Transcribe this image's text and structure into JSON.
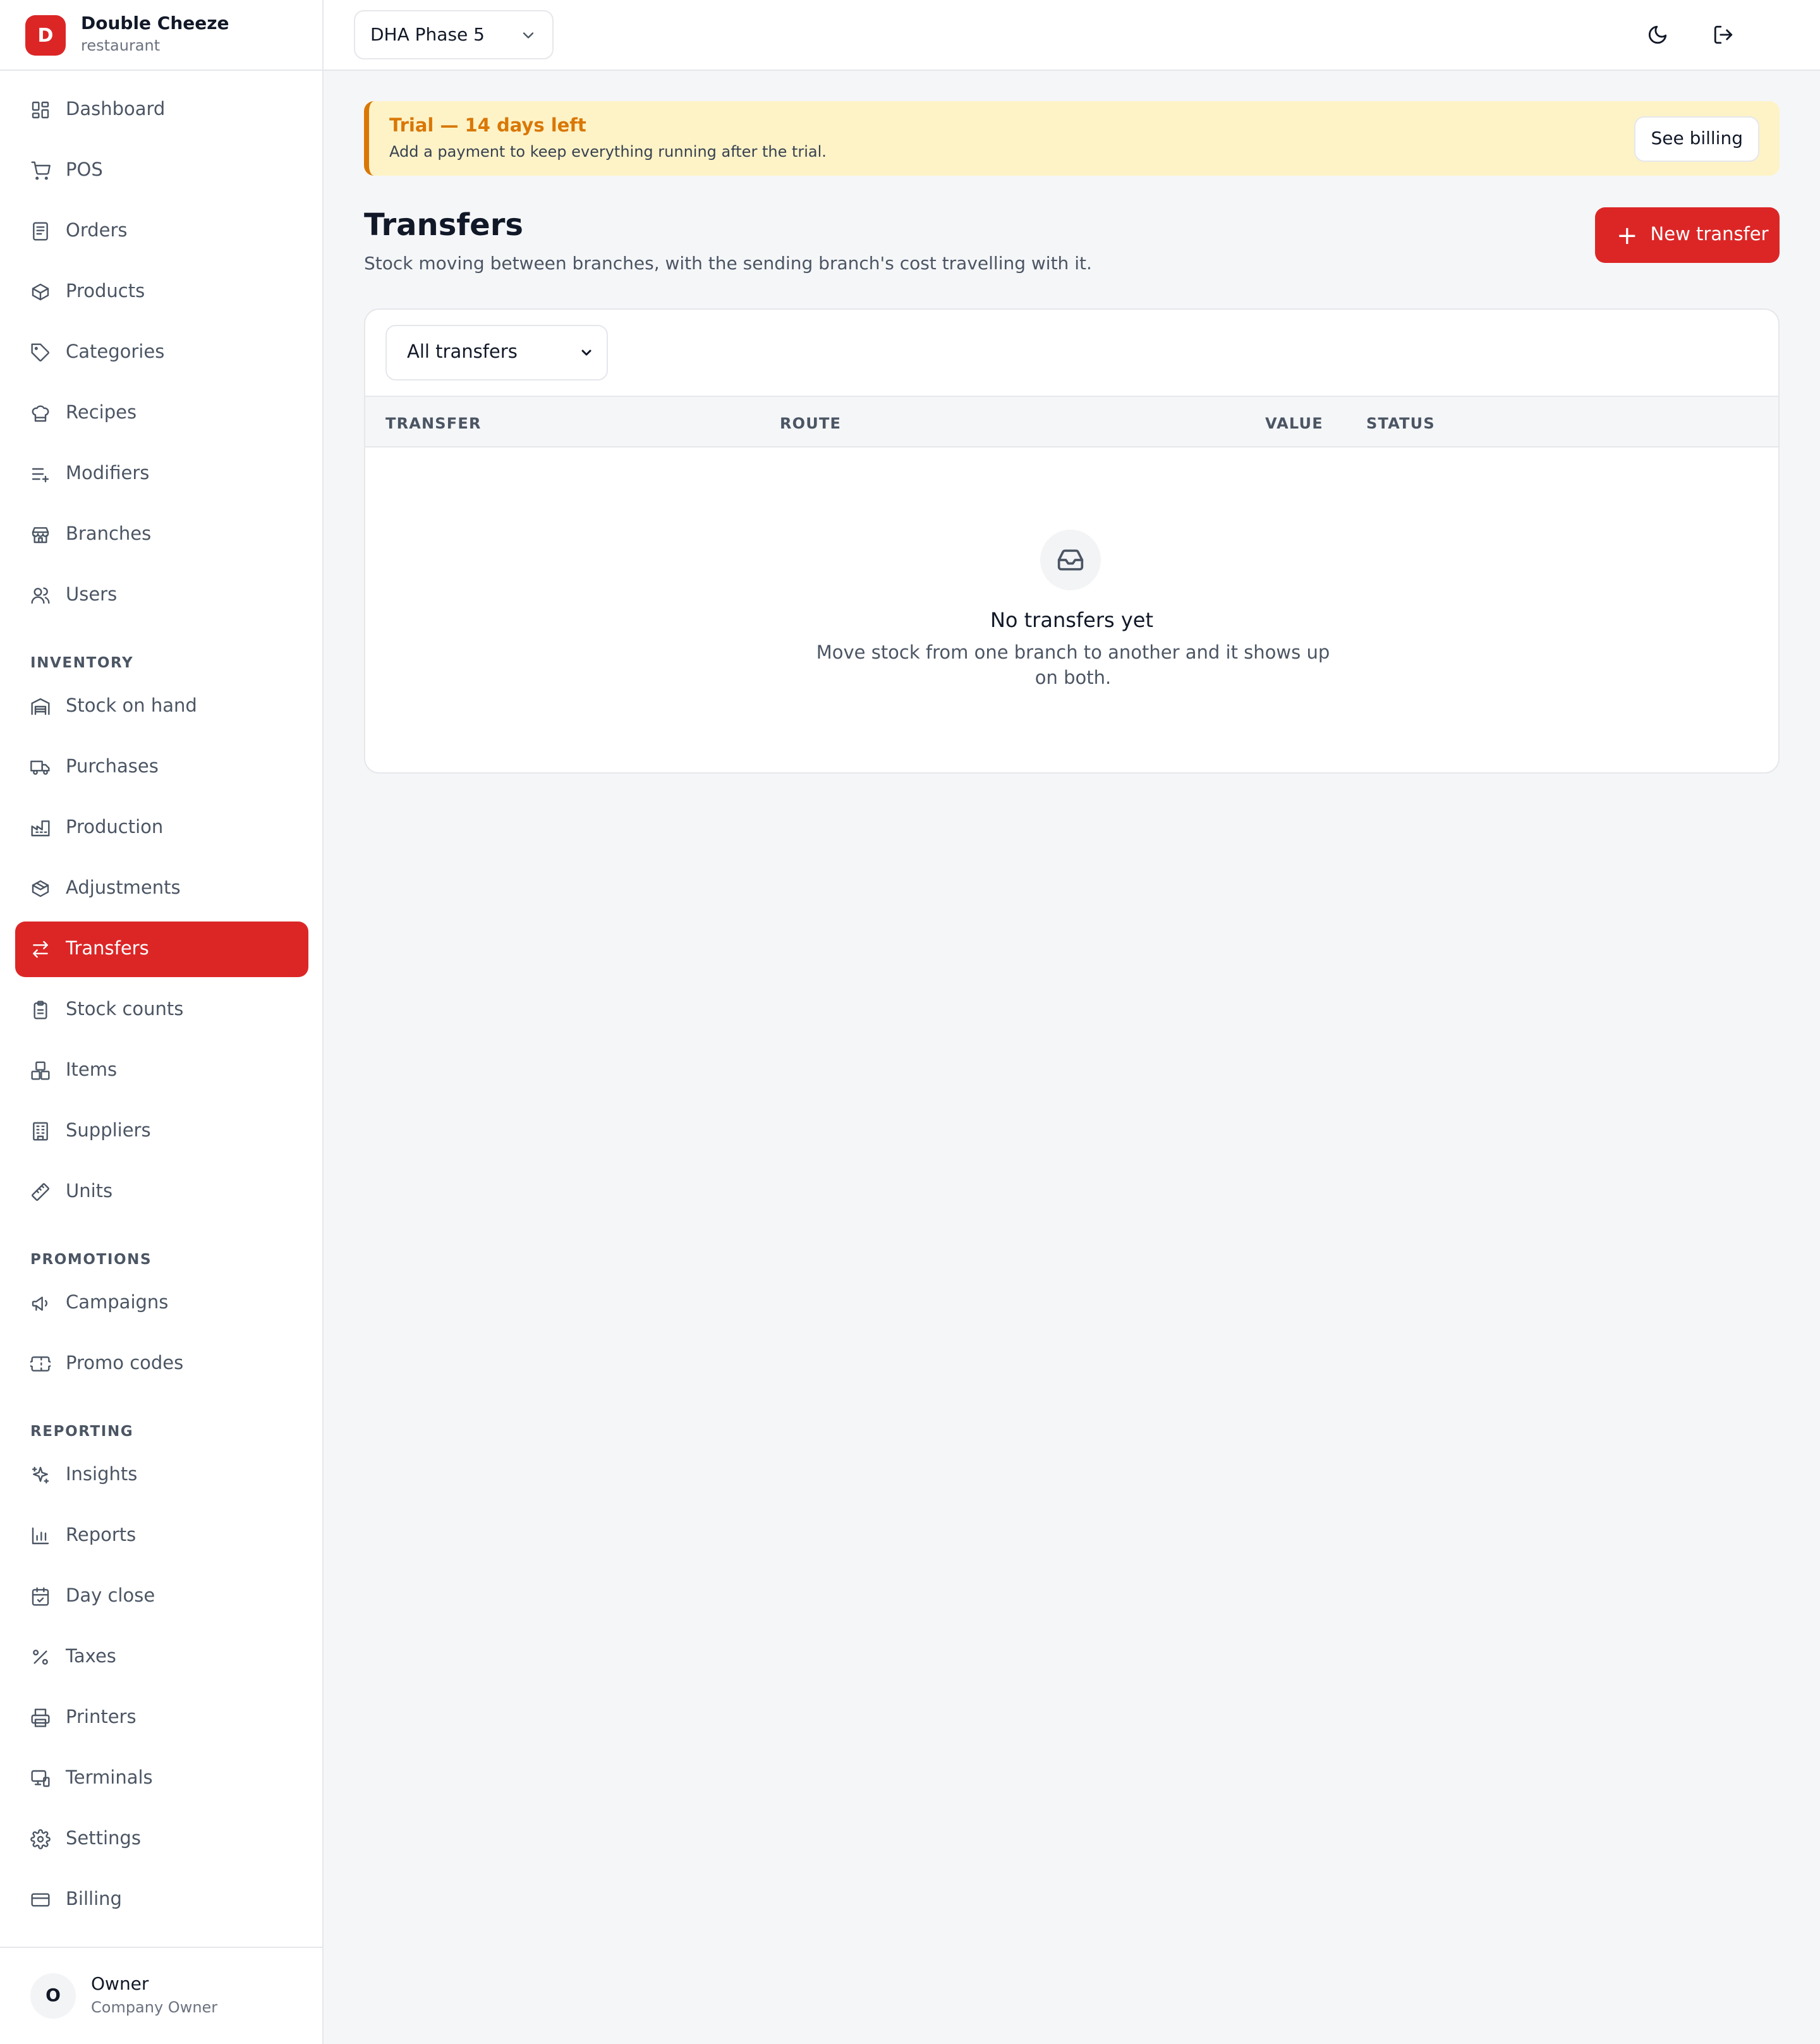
{
  "brand": {
    "initial": "D",
    "name": "Double Cheeze",
    "type": "restaurant"
  },
  "nav": {
    "main": [
      {
        "label": "Dashboard",
        "icon": "dashboard-icon"
      },
      {
        "label": "POS",
        "icon": "cart-icon"
      },
      {
        "label": "Orders",
        "icon": "receipt-icon"
      },
      {
        "label": "Products",
        "icon": "box-icon"
      },
      {
        "label": "Categories",
        "icon": "tag-icon"
      },
      {
        "label": "Recipes",
        "icon": "chef-hat-icon"
      },
      {
        "label": "Modifiers",
        "icon": "list-plus-icon"
      },
      {
        "label": "Branches",
        "icon": "store-icon"
      },
      {
        "label": "Users",
        "icon": "users-icon"
      }
    ],
    "inventory_title": "INVENTORY",
    "inventory": [
      {
        "label": "Stock on hand",
        "icon": "warehouse-icon"
      },
      {
        "label": "Purchases",
        "icon": "truck-icon"
      },
      {
        "label": "Production",
        "icon": "factory-icon"
      },
      {
        "label": "Adjustments",
        "icon": "package-icon"
      },
      {
        "label": "Transfers",
        "icon": "arrows-transfer-icon",
        "active": true
      },
      {
        "label": "Stock counts",
        "icon": "clipboard-icon"
      },
      {
        "label": "Items",
        "icon": "boxes-icon"
      },
      {
        "label": "Suppliers",
        "icon": "building-icon"
      },
      {
        "label": "Units",
        "icon": "ruler-icon"
      }
    ],
    "promotions_title": "PROMOTIONS",
    "promotions": [
      {
        "label": "Campaigns",
        "icon": "megaphone-icon"
      },
      {
        "label": "Promo codes",
        "icon": "ticket-icon"
      }
    ],
    "reporting_title": "REPORTING",
    "reporting": [
      {
        "label": "Insights",
        "icon": "sparkles-icon"
      },
      {
        "label": "Reports",
        "icon": "bar-chart-icon"
      },
      {
        "label": "Day close",
        "icon": "calendar-check-icon"
      },
      {
        "label": "Taxes",
        "icon": "percent-icon"
      },
      {
        "label": "Printers",
        "icon": "printer-icon"
      },
      {
        "label": "Terminals",
        "icon": "monitor-icon"
      },
      {
        "label": "Settings",
        "icon": "gear-icon"
      },
      {
        "label": "Billing",
        "icon": "credit-card-icon"
      }
    ]
  },
  "user": {
    "initial": "O",
    "name": "Owner",
    "role": "Company Owner"
  },
  "topbar": {
    "branch": "DHA Phase 5"
  },
  "trial": {
    "title": "Trial — 14 days left",
    "subtitle": "Add a payment to keep everything running after the trial.",
    "button": "See billing"
  },
  "page": {
    "title": "Transfers",
    "subtitle": "Stock moving between branches, with the sending branch's cost travelling with it.",
    "new_button": "New transfer"
  },
  "table": {
    "filter": "All transfers",
    "columns": [
      "TRANSFER",
      "ROUTE",
      "VALUE",
      "STATUS"
    ],
    "empty_title": "No transfers yet",
    "empty_subtitle": "Move stock from one branch to another and it shows up on both."
  },
  "colors": {
    "accent": "#dc2626",
    "warning": "#d97706",
    "warning_bg": "#fef3c7"
  }
}
